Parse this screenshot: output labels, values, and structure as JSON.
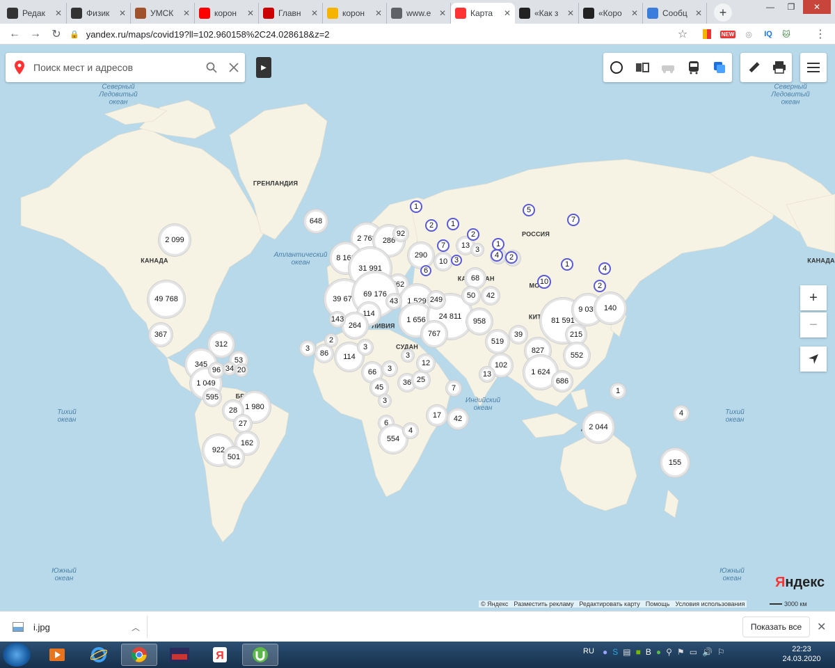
{
  "browser": {
    "tabs": [
      {
        "label": "Редак",
        "icon": "plus-square-icon",
        "color": "#333333"
      },
      {
        "label": "Физик",
        "icon": "plus-square-icon",
        "color": "#333333"
      },
      {
        "label": "УМСК",
        "icon": "owl-icon",
        "color": "#a0522d"
      },
      {
        "label": "корон",
        "icon": "yandex-icon",
        "color": "#ff0000"
      },
      {
        "label": "Главн",
        "icon": "newspaper-icon",
        "color": "#cc0000"
      },
      {
        "label": "корон",
        "icon": "image-icon",
        "color": "#f5b400"
      },
      {
        "label": "www.e",
        "icon": "globe-icon",
        "color": "#5f6368"
      },
      {
        "label": "Карта",
        "icon": "map-pin-icon",
        "color": "#ff3333",
        "active": true
      },
      {
        "label": "«Как з",
        "icon": "q-icon",
        "color": "#222222"
      },
      {
        "label": "«Коро",
        "icon": "q-icon",
        "color": "#222222"
      },
      {
        "label": "Сообц",
        "icon": "chat-icon",
        "color": "#3b7ddd"
      }
    ],
    "url": "yandex.ru/maps/covid19?ll=102.960158%2C24.028618&z=2",
    "extensions": [
      "bookmark-flag-icon",
      "new-badge-icon",
      "sync-icon",
      "iq-icon",
      "cat-avatar-icon"
    ],
    "ext_labels": {
      "new": "NEW",
      "iq": "IQ"
    }
  },
  "map": {
    "search_placeholder": "Поиск мест и адресов",
    "controls": [
      "traffic-icon",
      "layers-icon",
      "parking-icon",
      "transit-icon",
      "panorama-icon"
    ],
    "tools": [
      "ruler-icon",
      "print-icon"
    ],
    "menu_icon": "menu-icon",
    "zoom_in": "+",
    "zoom_out": "−",
    "logo": "Яндекс",
    "copyright": [
      "© Яндекс",
      "Разместить рекламу",
      "Редактировать карту",
      "Помощь",
      "Условия использования"
    ],
    "scale_label": "3000 км",
    "labels": {
      "ocean_nw": "Северный\nЛедовитый\nокеан",
      "ocean_ne": "Северный\nЛедовитый\nокеан",
      "greenland": "ГРЕНЛАНДИЯ",
      "canada": "КАНАДА",
      "canada_right": "КАНАДА",
      "russia": "РОССИЯ",
      "atlantic": "Атлантический\nокеан",
      "pacific_w": "Тихий\nокеан",
      "pacific_e": "Тихий\nокеан",
      "indian": "Индийский\nокеан",
      "south_w": "Южный\nокеан",
      "south_e": "Южный\nокеан",
      "china": "КИТА",
      "kazakhstan": "КА",
      "kazakhstan_2": "АН",
      "mongolia": "МО",
      "libya": "ЛИВИЯ",
      "sudan": "СУДАН",
      "brazil": "БР",
      "australia": "А"
    },
    "clusters": [
      {
        "label": "2 099"
      },
      {
        "label": "648"
      },
      {
        "label": "49 768"
      },
      {
        "label": "367"
      },
      {
        "label": "312"
      },
      {
        "label": "345"
      },
      {
        "label": "1 049"
      },
      {
        "label": "53"
      },
      {
        "label": "1 980"
      },
      {
        "label": "28"
      },
      {
        "label": "27"
      },
      {
        "label": "162"
      },
      {
        "label": "922"
      },
      {
        "label": "501"
      },
      {
        "label": "2 768"
      },
      {
        "label": "286"
      },
      {
        "label": "8 163"
      },
      {
        "label": "31 991"
      },
      {
        "label": "762"
      },
      {
        "label": "39 676"
      },
      {
        "label": "69 176"
      },
      {
        "label": "1 529"
      },
      {
        "label": "114"
      },
      {
        "label": "1 656"
      },
      {
        "label": "24 811"
      },
      {
        "label": "264"
      },
      {
        "label": "767"
      },
      {
        "label": "958"
      },
      {
        "label": "68"
      },
      {
        "label": "50"
      },
      {
        "label": "42"
      },
      {
        "label": "519"
      },
      {
        "label": "39"
      },
      {
        "label": "81 591"
      },
      {
        "label": "9 037"
      },
      {
        "label": "140"
      },
      {
        "label": "215"
      },
      {
        "label": "827"
      },
      {
        "label": "552"
      },
      {
        "label": "1 624"
      },
      {
        "label": "686"
      },
      {
        "label": "102"
      },
      {
        "label": "13"
      },
      {
        "label": "114"
      },
      {
        "label": "86"
      },
      {
        "label": "3"
      },
      {
        "label": "66"
      },
      {
        "label": "36"
      },
      {
        "label": "45"
      },
      {
        "label": "25"
      },
      {
        "label": "12"
      },
      {
        "label": "7"
      },
      {
        "label": "17"
      },
      {
        "label": "42"
      },
      {
        "label": "6"
      },
      {
        "label": "554"
      },
      {
        "label": "4"
      },
      {
        "label": "2 044"
      },
      {
        "label": "155"
      },
      {
        "label": "1"
      },
      {
        "label": "4"
      },
      {
        "label": "290"
      },
      {
        "label": "10"
      },
      {
        "label": "13"
      },
      {
        "label": "4"
      },
      {
        "label": "2"
      },
      {
        "label": "3"
      },
      {
        "label": "3"
      },
      {
        "label": "3"
      },
      {
        "label": "2"
      },
      {
        "label": "3"
      },
      {
        "label": "3"
      },
      {
        "label": "43"
      },
      {
        "label": "249"
      },
      {
        "label": "143"
      },
      {
        "label": "96"
      },
      {
        "label": "34"
      },
      {
        "label": "20"
      },
      {
        "label": "595"
      },
      {
        "label": "92"
      }
    ],
    "blue_clusters": [
      {
        "label": "1"
      },
      {
        "label": "2"
      },
      {
        "label": "1"
      },
      {
        "label": "2"
      },
      {
        "label": "7"
      },
      {
        "label": "1"
      },
      {
        "label": "3"
      },
      {
        "label": "4"
      },
      {
        "label": "2"
      },
      {
        "label": "5"
      },
      {
        "label": "7"
      },
      {
        "label": "1"
      },
      {
        "label": "4"
      },
      {
        "label": "2"
      },
      {
        "label": "10"
      },
      {
        "label": "6"
      }
    ]
  },
  "download": {
    "file": "i.jpg",
    "show_all": "Показать все"
  },
  "taskbar": {
    "lang": "RU",
    "time": "22:23",
    "date": "24.03.2020"
  }
}
